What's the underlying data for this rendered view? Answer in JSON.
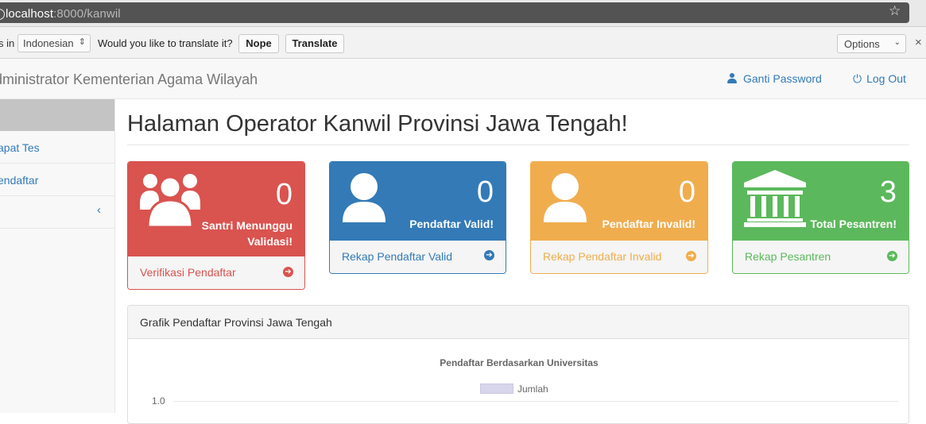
{
  "browser": {
    "url_host": "localhost",
    "url_path": ":8000/kanwil",
    "icons": {
      "info": "info-icon",
      "bookmark": "star-icon"
    }
  },
  "translate_bar": {
    "prefix": "s in",
    "language": "Indonesian",
    "question": "Would you like to translate it?",
    "nope": "Nope",
    "translate": "Translate",
    "options": "Options",
    "close": "×"
  },
  "navbar": {
    "brand": "dministrator Kementerian Agama Wilayah",
    "ganti_password": "Ganti Password",
    "log_out": "Log Out"
  },
  "sidebar": {
    "items": [
      {
        "label": "apat Tes"
      },
      {
        "label": "endaftar"
      }
    ],
    "collapse": "‹"
  },
  "main": {
    "title": "Halaman Operator Kanwil Provinsi Jawa Tengah!",
    "panels": [
      {
        "count": "0",
        "caption_line1": "Santri Menunggu",
        "caption_line2": "Validasi!",
        "link": "Verifikasi Pendaftar",
        "color": "#d9534f",
        "icon": "users-icon"
      },
      {
        "count": "0",
        "caption_line1": "Pendaftar Valid!",
        "caption_line2": "",
        "link": "Rekap Pendaftar Valid",
        "color": "#337ab7",
        "icon": "user-icon"
      },
      {
        "count": "0",
        "caption_line1": "Pendaftar Invalid!",
        "caption_line2": "",
        "link": "Rekap Pendaftar Invalid",
        "color": "#f0ad4e",
        "icon": "user-icon"
      },
      {
        "count": "3",
        "caption_line1": "Total Pesantren!",
        "caption_line2": "",
        "link": "Rekap Pesantren",
        "color": "#5cb85c",
        "icon": "institution-icon"
      }
    ]
  },
  "chart_panel": {
    "heading": "Grafik Pendaftar Provinsi Jawa Tengah"
  },
  "chart_data": {
    "type": "bar",
    "title": "Pendaftar Berdasarkan Universitas",
    "series": [
      {
        "name": "Jumlah",
        "values": []
      }
    ],
    "y_ticks": [
      "1.0"
    ],
    "legend_position": "top",
    "legend_color": "#d8d6ea"
  }
}
